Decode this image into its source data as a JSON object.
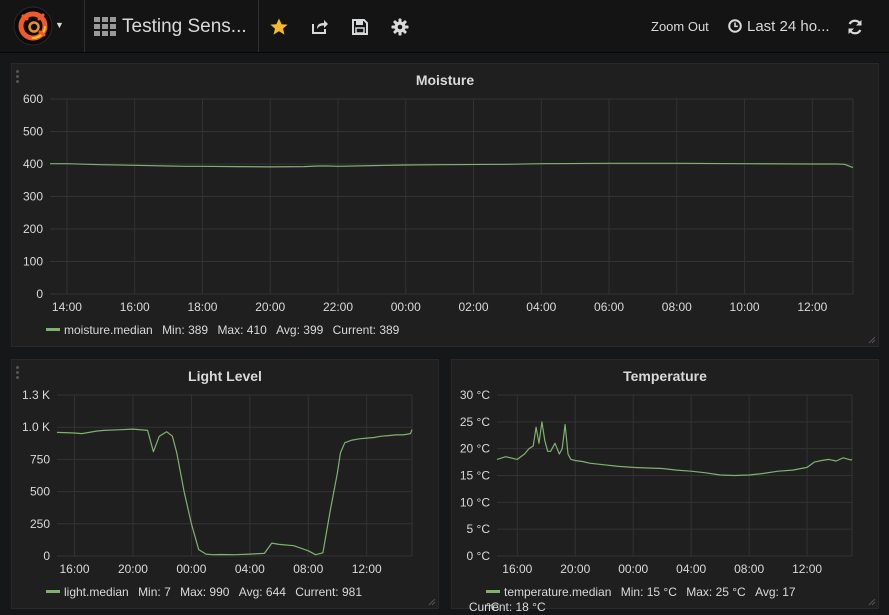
{
  "navbar": {
    "dashboard_title": "Testing Sens...",
    "zoom_out_label": "Zoom Out",
    "time_range_label": "Last 24 ho...",
    "icons": [
      "grafana-logo-icon",
      "caret-down-icon",
      "dashboard-grid-icon",
      "star-icon",
      "share-icon",
      "save-icon",
      "settings-gear-icon",
      "clock-icon",
      "refresh-icon"
    ]
  },
  "colors": {
    "series": "#7eb26d",
    "star": "#f5b82e",
    "panel_bg": "#1f1f20",
    "page_bg": "#161719"
  },
  "panels": {
    "moisture": {
      "title": "Moisture",
      "legend": {
        "series": "moisture.median",
        "min": "Min: 389",
        "max": "Max: 410",
        "avg": "Avg: 399",
        "current": "Current: 389"
      }
    },
    "light": {
      "title": "Light Level",
      "legend": {
        "series": "light.median",
        "min": "Min: 7",
        "max": "Max: 990",
        "avg": "Avg: 644",
        "current": "Current: 981"
      }
    },
    "temperature": {
      "title": "Temperature",
      "legend": {
        "series": "temperature.median",
        "min": "Min: 15 °C",
        "max": "Max: 25 °C",
        "avg": "Avg: 17 °C",
        "current": "Current: 18 °C"
      }
    }
  },
  "chart_data": [
    {
      "type": "line",
      "title": "Moisture",
      "y_ticks": [
        "0",
        "100",
        "200",
        "300",
        "400",
        "500",
        "600"
      ],
      "ylim": [
        0,
        600
      ],
      "x_ticks": [
        "14:00",
        "16:00",
        "18:00",
        "20:00",
        "22:00",
        "00:00",
        "02:00",
        "04:00",
        "06:00",
        "08:00",
        "10:00",
        "12:00"
      ],
      "xlim": [
        -0.5,
        23.2
      ],
      "grid": true,
      "series": [
        {
          "name": "moisture.median",
          "x": [
            -0.5,
            0,
            1,
            2,
            3,
            3.5,
            4,
            5,
            6,
            7,
            7.4,
            7.7,
            8,
            9,
            10,
            11,
            13,
            14,
            16,
            18,
            20,
            22,
            22.7,
            22.95,
            23.2
          ],
          "values": [
            401,
            401,
            398,
            396,
            394,
            393,
            393,
            392,
            391,
            392,
            394,
            394,
            393,
            395,
            397,
            398,
            399,
            401,
            402,
            402,
            401,
            400,
            400,
            399,
            389
          ]
        }
      ]
    },
    {
      "type": "line",
      "title": "Light Level",
      "y_ticks": [
        "0",
        "250",
        "500",
        "750",
        "1.0 K",
        "1.3 K"
      ],
      "ylim": [
        0,
        1250
      ],
      "x_ticks": [
        "16:00",
        "20:00",
        "00:00",
        "04:00",
        "08:00",
        "12:00"
      ],
      "xlim": [
        -1.2,
        23.1
      ],
      "grid": true,
      "series": [
        {
          "name": "light.median",
          "x": [
            -1.2,
            0,
            0.5,
            1,
            1.5,
            2,
            3,
            4,
            5,
            5.4,
            5.8,
            6.3,
            6.7,
            7,
            7.5,
            8,
            8.5,
            9,
            9.5,
            10,
            11,
            12,
            13,
            13.5,
            14,
            15,
            16,
            16.5,
            17,
            17.5,
            18,
            18.2,
            18.5,
            19,
            19.5,
            20,
            20.5,
            21,
            21.5,
            22,
            22.5,
            23,
            23.1
          ],
          "values": [
            960,
            955,
            950,
            960,
            970,
            975,
            980,
            985,
            975,
            810,
            930,
            965,
            930,
            800,
            500,
            250,
            50,
            15,
            10,
            12,
            10,
            15,
            20,
            100,
            90,
            80,
            40,
            10,
            25,
            350,
            650,
            800,
            880,
            900,
            910,
            915,
            920,
            930,
            935,
            940,
            940,
            950,
            981
          ]
        }
      ]
    },
    {
      "type": "line",
      "title": "Temperature",
      "y_ticks": [
        "0 °C",
        "5 °C",
        "10 °C",
        "15 °C",
        "20 °C",
        "25 °C",
        "30 °C"
      ],
      "ylim": [
        0,
        30
      ],
      "x_ticks": [
        "16:00",
        "20:00",
        "00:00",
        "04:00",
        "08:00",
        "12:00"
      ],
      "xlim": [
        -1.4,
        23.1
      ],
      "grid": true,
      "series": [
        {
          "name": "temperature.median",
          "x": [
            -1.4,
            -0.8,
            0,
            0.5,
            0.8,
            1.1,
            1.3,
            1.5,
            1.7,
            1.9,
            2.1,
            2.3,
            2.6,
            2.9,
            3.1,
            3.3,
            3.5,
            3.7,
            4,
            4.5,
            5,
            6,
            7,
            8,
            9,
            10,
            11,
            12,
            13,
            14,
            15,
            16,
            17,
            18,
            19,
            20,
            20.5,
            21,
            21.5,
            22,
            22.5,
            23,
            23.1
          ],
          "values": [
            18,
            18.5,
            18,
            19,
            20,
            20.5,
            24,
            21,
            25,
            21.5,
            19.5,
            19.5,
            21,
            19,
            20,
            24.5,
            19,
            18,
            17.8,
            17.6,
            17.3,
            17,
            16.7,
            16.5,
            16.4,
            16.3,
            16,
            15.8,
            15.5,
            15.1,
            15,
            15.1,
            15.4,
            15.8,
            16,
            16.5,
            17.5,
            17.8,
            18,
            17.7,
            18.3,
            17.9,
            18
          ]
        }
      ]
    }
  ]
}
